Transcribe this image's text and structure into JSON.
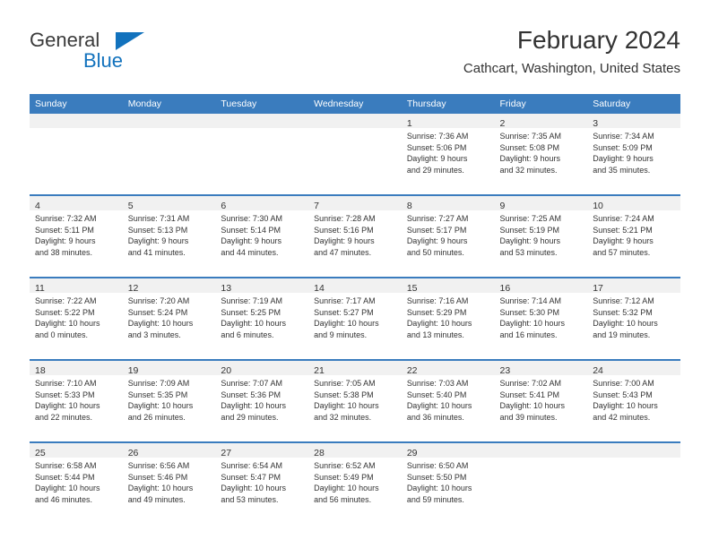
{
  "brand": {
    "word_one": "General",
    "word_two": "Blue",
    "triangle_icon": "brand-triangle-icon",
    "accent_color": "#1272bd"
  },
  "header": {
    "title": "February 2024",
    "subtitle": "Cathcart, Washington, United States"
  },
  "theme": {
    "header_blue": "#3a7cbe",
    "daynum_band": "#f1f1f1",
    "text": "#333333"
  },
  "calendar": {
    "weekday_headers": [
      "Sunday",
      "Monday",
      "Tuesday",
      "Wednesday",
      "Thursday",
      "Friday",
      "Saturday"
    ],
    "weeks": [
      [
        {
          "day": "",
          "lines": []
        },
        {
          "day": "",
          "lines": []
        },
        {
          "day": "",
          "lines": []
        },
        {
          "day": "",
          "lines": []
        },
        {
          "day": "1",
          "lines": [
            "Sunrise: 7:36 AM",
            "Sunset: 5:06 PM",
            "Daylight: 9 hours",
            "and 29 minutes."
          ]
        },
        {
          "day": "2",
          "lines": [
            "Sunrise: 7:35 AM",
            "Sunset: 5:08 PM",
            "Daylight: 9 hours",
            "and 32 minutes."
          ]
        },
        {
          "day": "3",
          "lines": [
            "Sunrise: 7:34 AM",
            "Sunset: 5:09 PM",
            "Daylight: 9 hours",
            "and 35 minutes."
          ]
        }
      ],
      [
        {
          "day": "4",
          "lines": [
            "Sunrise: 7:32 AM",
            "Sunset: 5:11 PM",
            "Daylight: 9 hours",
            "and 38 minutes."
          ]
        },
        {
          "day": "5",
          "lines": [
            "Sunrise: 7:31 AM",
            "Sunset: 5:13 PM",
            "Daylight: 9 hours",
            "and 41 minutes."
          ]
        },
        {
          "day": "6",
          "lines": [
            "Sunrise: 7:30 AM",
            "Sunset: 5:14 PM",
            "Daylight: 9 hours",
            "and 44 minutes."
          ]
        },
        {
          "day": "7",
          "lines": [
            "Sunrise: 7:28 AM",
            "Sunset: 5:16 PM",
            "Daylight: 9 hours",
            "and 47 minutes."
          ]
        },
        {
          "day": "8",
          "lines": [
            "Sunrise: 7:27 AM",
            "Sunset: 5:17 PM",
            "Daylight: 9 hours",
            "and 50 minutes."
          ]
        },
        {
          "day": "9",
          "lines": [
            "Sunrise: 7:25 AM",
            "Sunset: 5:19 PM",
            "Daylight: 9 hours",
            "and 53 minutes."
          ]
        },
        {
          "day": "10",
          "lines": [
            "Sunrise: 7:24 AM",
            "Sunset: 5:21 PM",
            "Daylight: 9 hours",
            "and 57 minutes."
          ]
        }
      ],
      [
        {
          "day": "11",
          "lines": [
            "Sunrise: 7:22 AM",
            "Sunset: 5:22 PM",
            "Daylight: 10 hours",
            "and 0 minutes."
          ]
        },
        {
          "day": "12",
          "lines": [
            "Sunrise: 7:20 AM",
            "Sunset: 5:24 PM",
            "Daylight: 10 hours",
            "and 3 minutes."
          ]
        },
        {
          "day": "13",
          "lines": [
            "Sunrise: 7:19 AM",
            "Sunset: 5:25 PM",
            "Daylight: 10 hours",
            "and 6 minutes."
          ]
        },
        {
          "day": "14",
          "lines": [
            "Sunrise: 7:17 AM",
            "Sunset: 5:27 PM",
            "Daylight: 10 hours",
            "and 9 minutes."
          ]
        },
        {
          "day": "15",
          "lines": [
            "Sunrise: 7:16 AM",
            "Sunset: 5:29 PM",
            "Daylight: 10 hours",
            "and 13 minutes."
          ]
        },
        {
          "day": "16",
          "lines": [
            "Sunrise: 7:14 AM",
            "Sunset: 5:30 PM",
            "Daylight: 10 hours",
            "and 16 minutes."
          ]
        },
        {
          "day": "17",
          "lines": [
            "Sunrise: 7:12 AM",
            "Sunset: 5:32 PM",
            "Daylight: 10 hours",
            "and 19 minutes."
          ]
        }
      ],
      [
        {
          "day": "18",
          "lines": [
            "Sunrise: 7:10 AM",
            "Sunset: 5:33 PM",
            "Daylight: 10 hours",
            "and 22 minutes."
          ]
        },
        {
          "day": "19",
          "lines": [
            "Sunrise: 7:09 AM",
            "Sunset: 5:35 PM",
            "Daylight: 10 hours",
            "and 26 minutes."
          ]
        },
        {
          "day": "20",
          "lines": [
            "Sunrise: 7:07 AM",
            "Sunset: 5:36 PM",
            "Daylight: 10 hours",
            "and 29 minutes."
          ]
        },
        {
          "day": "21",
          "lines": [
            "Sunrise: 7:05 AM",
            "Sunset: 5:38 PM",
            "Daylight: 10 hours",
            "and 32 minutes."
          ]
        },
        {
          "day": "22",
          "lines": [
            "Sunrise: 7:03 AM",
            "Sunset: 5:40 PM",
            "Daylight: 10 hours",
            "and 36 minutes."
          ]
        },
        {
          "day": "23",
          "lines": [
            "Sunrise: 7:02 AM",
            "Sunset: 5:41 PM",
            "Daylight: 10 hours",
            "and 39 minutes."
          ]
        },
        {
          "day": "24",
          "lines": [
            "Sunrise: 7:00 AM",
            "Sunset: 5:43 PM",
            "Daylight: 10 hours",
            "and 42 minutes."
          ]
        }
      ],
      [
        {
          "day": "25",
          "lines": [
            "Sunrise: 6:58 AM",
            "Sunset: 5:44 PM",
            "Daylight: 10 hours",
            "and 46 minutes."
          ]
        },
        {
          "day": "26",
          "lines": [
            "Sunrise: 6:56 AM",
            "Sunset: 5:46 PM",
            "Daylight: 10 hours",
            "and 49 minutes."
          ]
        },
        {
          "day": "27",
          "lines": [
            "Sunrise: 6:54 AM",
            "Sunset: 5:47 PM",
            "Daylight: 10 hours",
            "and 53 minutes."
          ]
        },
        {
          "day": "28",
          "lines": [
            "Sunrise: 6:52 AM",
            "Sunset: 5:49 PM",
            "Daylight: 10 hours",
            "and 56 minutes."
          ]
        },
        {
          "day": "29",
          "lines": [
            "Sunrise: 6:50 AM",
            "Sunset: 5:50 PM",
            "Daylight: 10 hours",
            "and 59 minutes."
          ]
        },
        {
          "day": "",
          "lines": []
        },
        {
          "day": "",
          "lines": []
        }
      ]
    ]
  }
}
